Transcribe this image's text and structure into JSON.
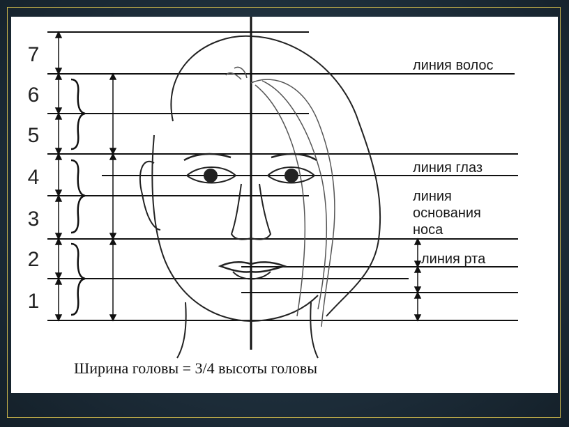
{
  "slide": {
    "accent_color": "#c9b44a",
    "background_color": "#1b2a36"
  },
  "diagram": {
    "section_numbers": [
      "7",
      "6",
      "5",
      "4",
      "3",
      "2",
      "1"
    ],
    "labels": {
      "hair_line": "линия волос",
      "eye_line": "линия глаз",
      "nose_base_line_1": "линия",
      "nose_base_line_2": "основания",
      "nose_base_line_3": "носа",
      "mouth_line": "линия рта"
    },
    "caption": "Ширина головы = 3/4 высоты головы"
  }
}
